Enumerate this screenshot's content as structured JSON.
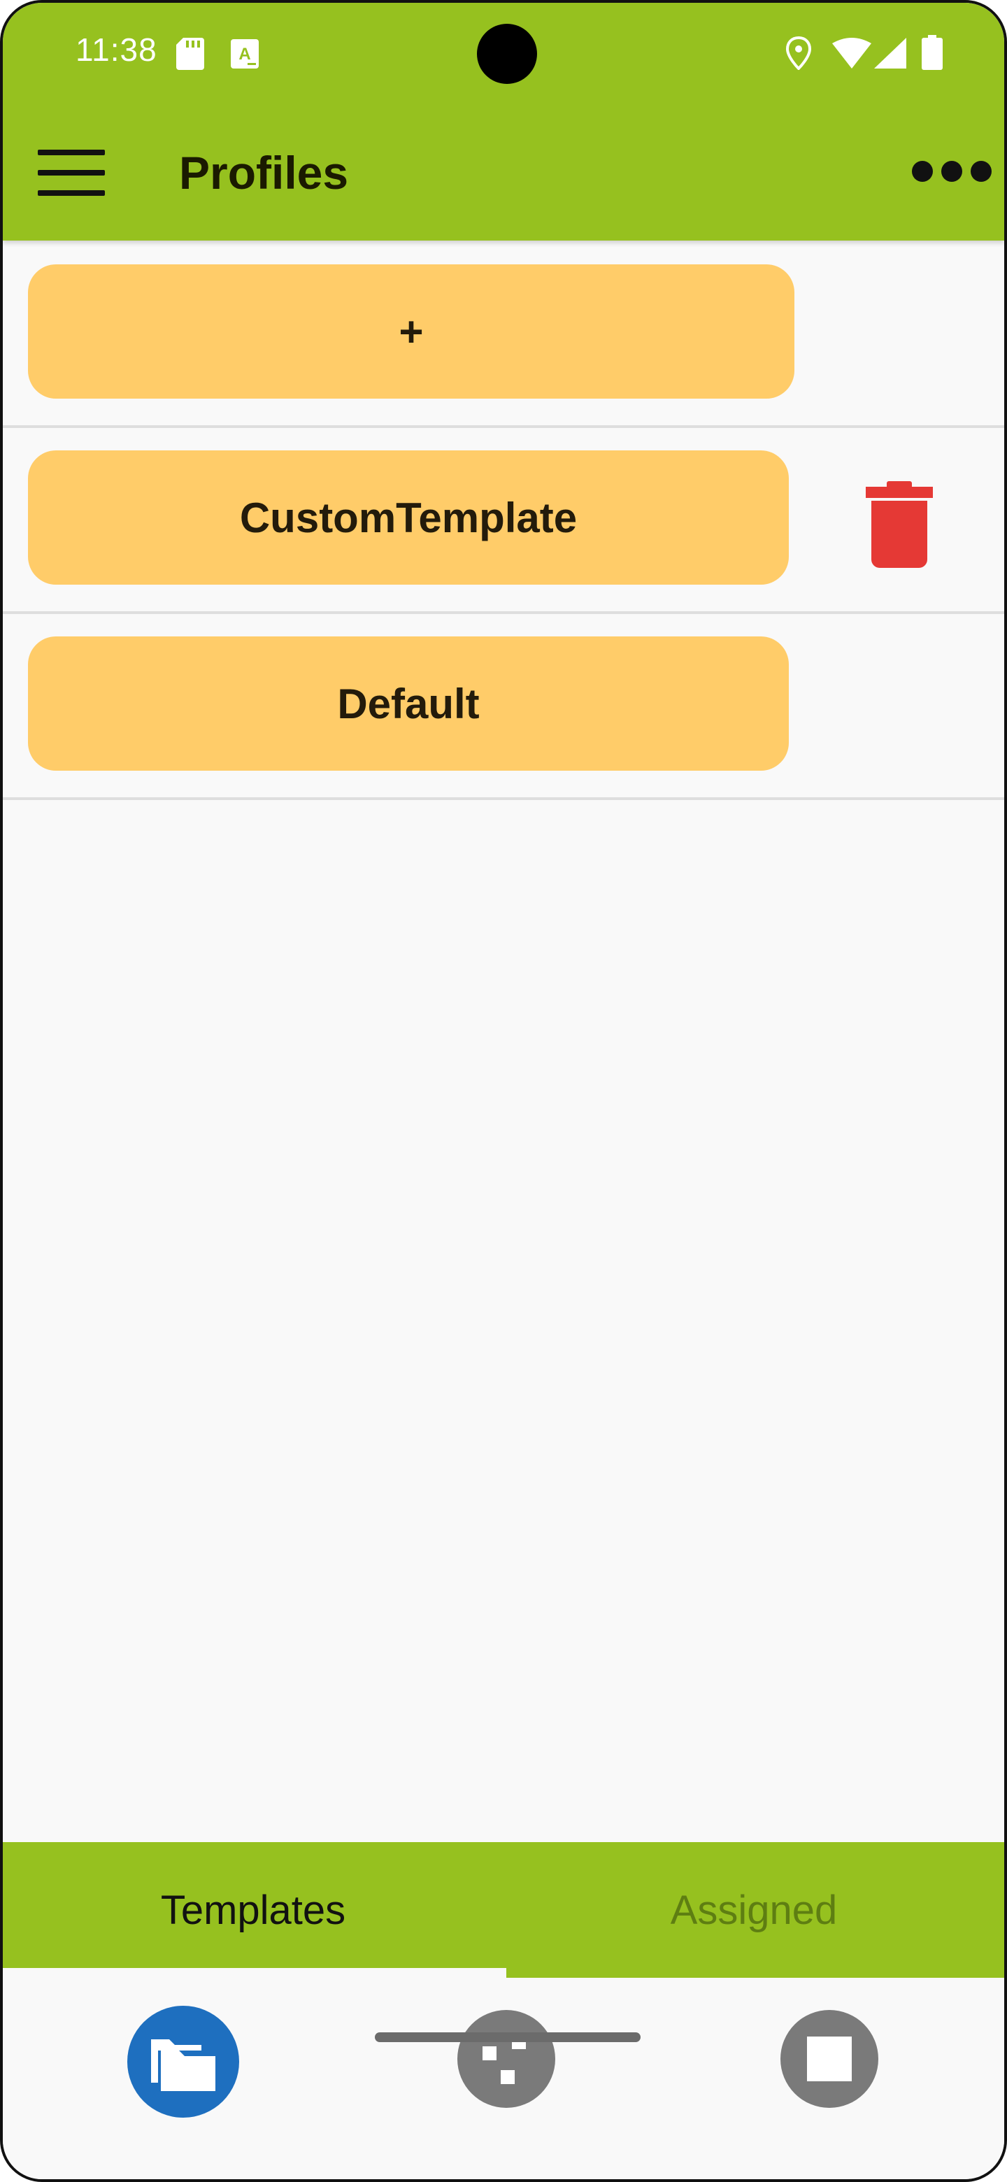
{
  "status_bar": {
    "time": "11:38",
    "icons": [
      "sd-card-icon",
      "a-notification-icon",
      "location-icon",
      "wifi-icon",
      "cell-signal-icon",
      "battery-icon"
    ]
  },
  "toolbar": {
    "title": "Profiles",
    "menu_icon": "hamburger-menu-icon",
    "more_icon": "more-options-icon"
  },
  "profiles": {
    "add_label": "+",
    "items": [
      {
        "label": "CustomTemplate",
        "deletable": true
      },
      {
        "label": "Default",
        "deletable": false
      }
    ]
  },
  "tabs": {
    "items": [
      {
        "label": "Templates",
        "selected": true
      },
      {
        "label": "Assigned",
        "selected": false
      }
    ]
  },
  "bottom_nav": {
    "items": [
      {
        "icon": "folder-icon",
        "selected": true
      },
      {
        "icon": "dice-icon",
        "selected": false
      },
      {
        "icon": "stop-icon",
        "selected": false
      }
    ]
  },
  "colors": {
    "app_bar": "#96c11f",
    "profile_button": "#ffcc69",
    "delete_icon": "#e53935",
    "selected_nav": "#1e6fbf",
    "unselected_nav": "#7a7a7a",
    "inactive_tab_text": "#5e7e12"
  }
}
